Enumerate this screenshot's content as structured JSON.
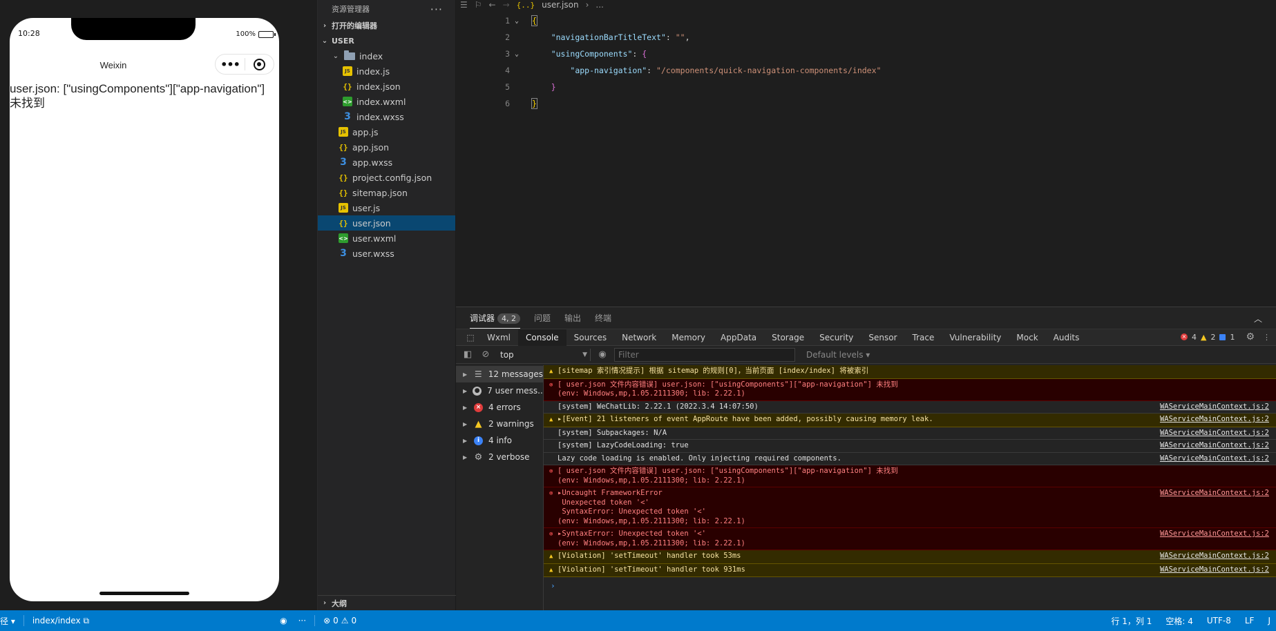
{
  "simulator": {
    "time": "10:28",
    "battery": "100%",
    "nav_title": "Weixin",
    "capsule_dots": "•••",
    "error_text": "user.json: [\"usingComponents\"][\"app-navigation\"] 未找到"
  },
  "explorer": {
    "title": "资源管理器",
    "open_editors": "打开的编辑器",
    "root": "USER",
    "folder": "index",
    "folder_files": [
      {
        "name": "index.js",
        "type": "js"
      },
      {
        "name": "index.json",
        "type": "json"
      },
      {
        "name": "index.wxml",
        "type": "wxml"
      },
      {
        "name": "index.wxss",
        "type": "wxss"
      }
    ],
    "files": [
      {
        "name": "app.js",
        "type": "js"
      },
      {
        "name": "app.json",
        "type": "json"
      },
      {
        "name": "app.wxss",
        "type": "wxss"
      },
      {
        "name": "project.config.json",
        "type": "json"
      },
      {
        "name": "sitemap.json",
        "type": "json"
      },
      {
        "name": "user.js",
        "type": "js"
      },
      {
        "name": "user.json",
        "type": "json",
        "selected": true
      },
      {
        "name": "user.wxml",
        "type": "wxml"
      },
      {
        "name": "user.wxss",
        "type": "wxss"
      }
    ],
    "outline": "大纲"
  },
  "editor": {
    "breadcrumb_file": "user.json",
    "breadcrumb_more": "...",
    "lines": [
      {
        "n": "1",
        "fold": true
      },
      {
        "n": "2"
      },
      {
        "n": "3",
        "fold": true
      },
      {
        "n": "4"
      },
      {
        "n": "5"
      },
      {
        "n": "6"
      }
    ],
    "key_title": "\"navigationBarTitleText\"",
    "val_title": "\"\"",
    "key_using": "\"usingComponents\"",
    "key_appnav": "\"app-navigation\"",
    "val_appnav": "\"/components/quick-navigation-components/index\""
  },
  "panel": {
    "tabs": [
      "调试器",
      "问题",
      "输出",
      "终端"
    ],
    "debugger_badge": "4, 2"
  },
  "devtools": {
    "tabs": [
      "Wxml",
      "Console",
      "Sources",
      "Network",
      "Memory",
      "AppData",
      "Storage",
      "Security",
      "Sensor",
      "Trace",
      "Vulnerability",
      "Mock",
      "Audits"
    ],
    "active_tab": "Console",
    "error_count": "4",
    "warn_count": "2",
    "info_count": "1",
    "context": "top",
    "filter_placeholder": "Filter",
    "levels": "Default levels"
  },
  "console_sidebar": [
    {
      "label": "12 messages",
      "icon": "list"
    },
    {
      "label": "7 user mess...",
      "icon": "user"
    },
    {
      "label": "4 errors",
      "icon": "error"
    },
    {
      "label": "2 warnings",
      "icon": "warning"
    },
    {
      "label": "4 info",
      "icon": "info"
    },
    {
      "label": "2 verbose",
      "icon": "verbose"
    }
  ],
  "console_messages": [
    {
      "level": "warn",
      "text": "[sitemap 索引情况提示] 根据 sitemap 的规则[0]，当前页面 [index/index] 将被索引",
      "source": ""
    },
    {
      "level": "error",
      "text": "[ user.json 文件内容错误] user.json: [\"usingComponents\"][\"app-navigation\"] 未找到\n(env: Windows,mp,1.05.2111300; lib: 2.22.1)",
      "source": ""
    },
    {
      "level": "log",
      "text": "[system] WeChatLib: 2.22.1 (2022.3.4 14:07:50)",
      "source": "WAServiceMainContext.js:2"
    },
    {
      "level": "warn",
      "text": "▸[Event] 21 listeners of event AppRoute have been added, possibly causing memory leak.",
      "source": "WAServiceMainContext.js:2"
    },
    {
      "level": "log",
      "text": "[system] Subpackages: N/A",
      "source": "WAServiceMainContext.js:2"
    },
    {
      "level": "log",
      "text": "[system] LazyCodeLoading: true",
      "source": "WAServiceMainContext.js:2"
    },
    {
      "level": "log",
      "text": "Lazy code loading is enabled. Only injecting required components.",
      "source": "WAServiceMainContext.js:2"
    },
    {
      "level": "error",
      "text": "[ user.json 文件内容错误] user.json: [\"usingComponents\"][\"app-navigation\"] 未找到\n(env: Windows,mp,1.05.2111300; lib: 2.22.1)",
      "source": ""
    },
    {
      "level": "error",
      "text": "▸Uncaught FrameworkError\n Unexpected token '<'\n SyntaxError: Unexpected token '<'\n(env: Windows,mp,1.05.2111300; lib: 2.22.1)",
      "source": "WAServiceMainContext.js:2"
    },
    {
      "level": "error",
      "text": "▸SyntaxError: Unexpected token '<'\n(env: Windows,mp,1.05.2111300; lib: 2.22.1)",
      "source": "WAServiceMainContext.js:2"
    },
    {
      "level": "warn",
      "text": "[Violation] 'setTimeout' handler took 53ms",
      "source": "WAServiceMainContext.js:2"
    },
    {
      "level": "warn",
      "text": "[Violation] 'setTimeout' handler took 931ms",
      "source": "WAServiceMainContext.js:2"
    }
  ],
  "statusbar": {
    "path_label": "径 ▾",
    "page_path": "index/index",
    "problems": "0",
    "warnings": "0",
    "cursor": "行 1，列 1",
    "spaces": "空格: 4",
    "encoding": "UTF-8",
    "eol": "LF",
    "lang": "J"
  },
  "colors": {
    "accent": "#007acc",
    "selection": "#094771",
    "error_bg": "#290000",
    "warn_bg": "#332b00"
  }
}
